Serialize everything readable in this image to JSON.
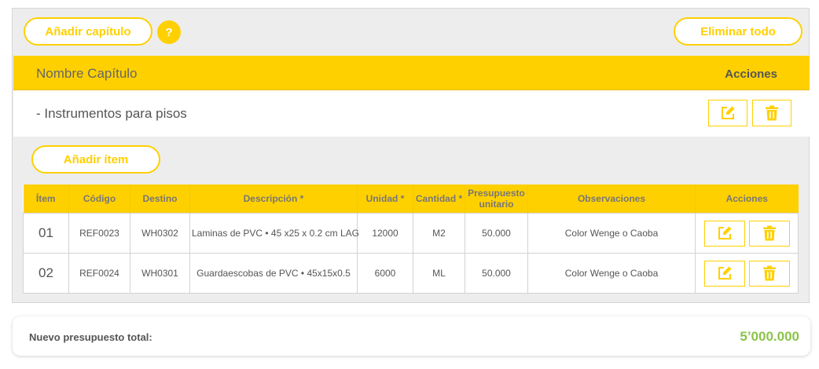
{
  "toolbar": {
    "add_chapter_label": "Añadir capítulo",
    "help_label": "?",
    "delete_all_label": "Eliminar todo"
  },
  "chapter_header": {
    "name_label": "Nombre Capítulo",
    "actions_label": "Acciones"
  },
  "chapter": {
    "title": "- Instrumentos para pisos",
    "edit_icon": "edit-icon",
    "delete_icon": "trash-icon"
  },
  "items": {
    "add_item_label": "Añadir ítem",
    "columns": {
      "item": "Ítem",
      "code": "Código",
      "destination": "Destino",
      "description": "Descripción *",
      "unit": "Unidad *",
      "quantity": "Cantidad *",
      "unit_budget": "Presupuesto unitario",
      "observations": "Observaciones",
      "actions": "Acciones"
    },
    "rows": [
      {
        "item": "01",
        "code": "REF0023",
        "destination": "WH0302",
        "description": "Laminas de PVC • 45 x25 x 0.2 cm LAG",
        "unit": "12000",
        "quantity": "M2",
        "unit_budget": "50.000",
        "observations": "Color Wenge o Caoba"
      },
      {
        "item": "02",
        "code": "REF0024",
        "destination": "WH0301",
        "description": "Guardaescobas de PVC • 45x15x0.5",
        "unit": "6000",
        "quantity": "ML",
        "unit_budget": "50.000",
        "observations": "Color Wenge o Caoba"
      }
    ]
  },
  "total": {
    "label": "Nuevo presupuesto total:",
    "value": "5’000.000"
  },
  "colors": {
    "accent": "#ffd000",
    "total_value": "#8bc34a",
    "panel_bg": "#ededed"
  }
}
